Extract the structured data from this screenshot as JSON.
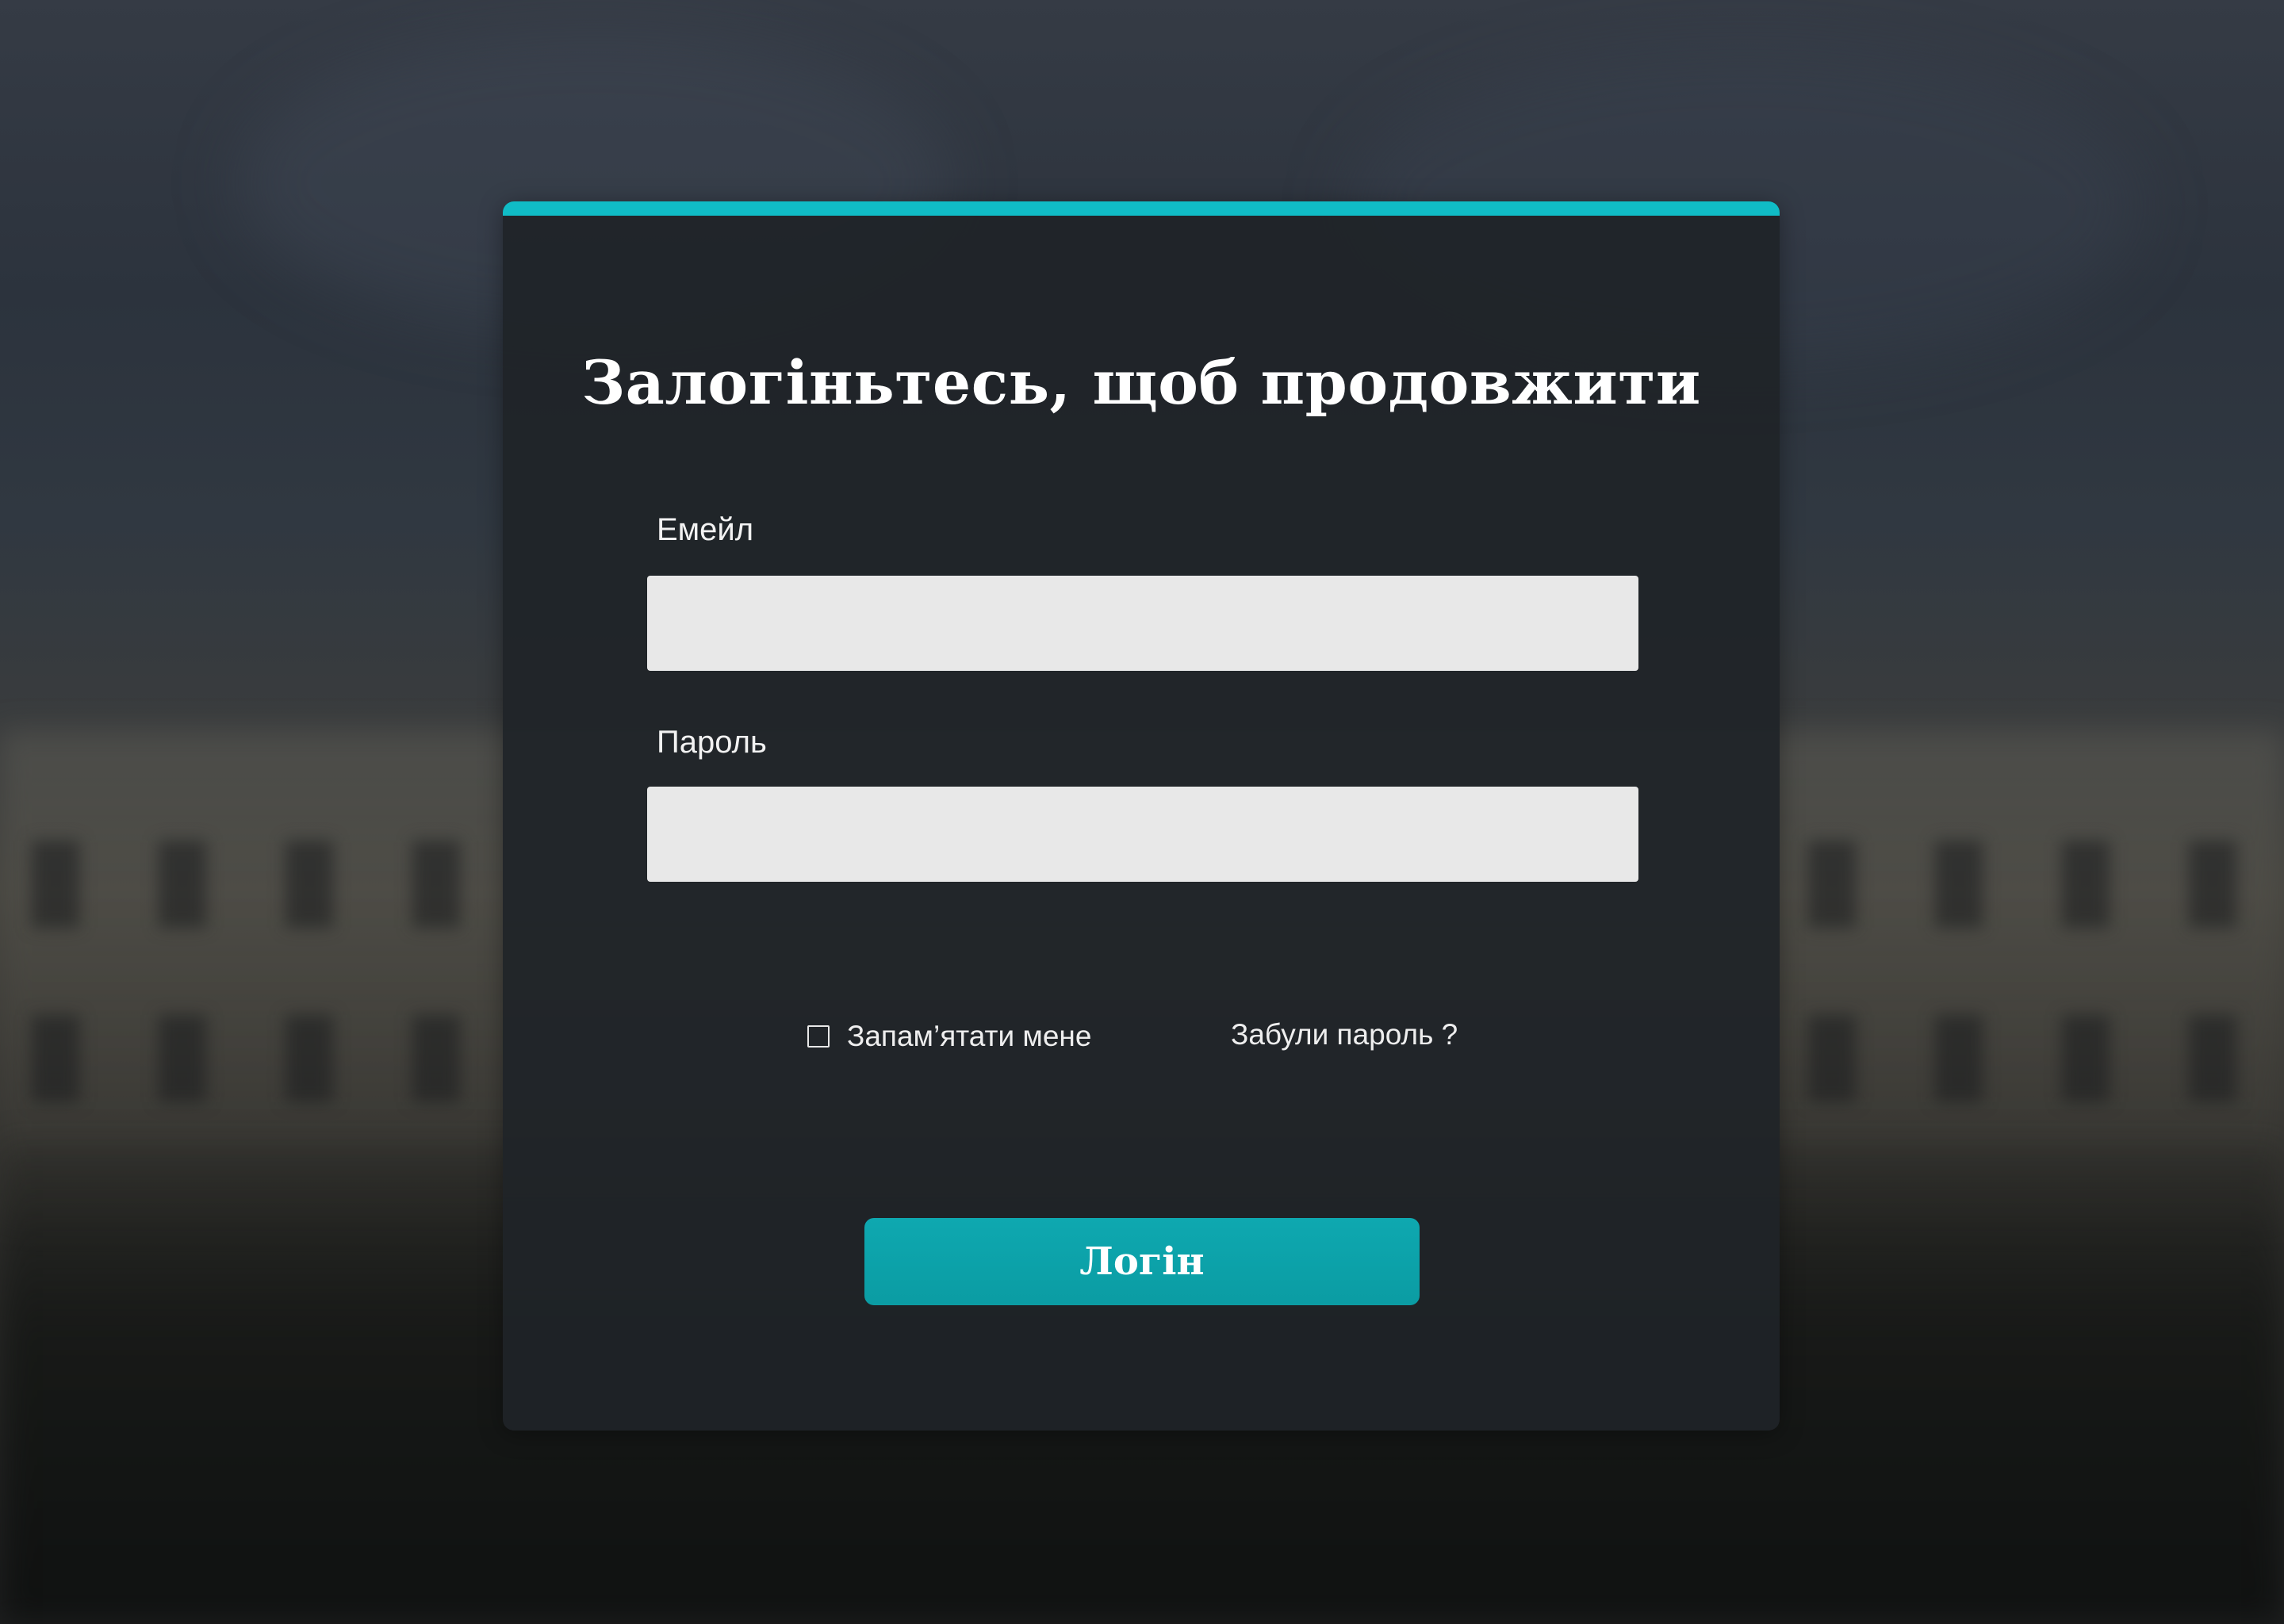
{
  "login_form": {
    "title": "Залогіньтесь, щоб продовжити",
    "email_label": "Емейл",
    "email_value": "",
    "password_label": "Пароль",
    "password_value": "",
    "remember_label": "Запам’ятати мене",
    "remember_checked": false,
    "forgot_label": "Забули пароль ?",
    "login_button": "Логін"
  },
  "colors": {
    "accent": "#10bcc6",
    "button": "#0ea8b0",
    "card_background": "#1f2328",
    "input_background": "#e8e8e8"
  },
  "icons": {
    "remember_checkbox": "checkbox-unchecked-icon"
  }
}
